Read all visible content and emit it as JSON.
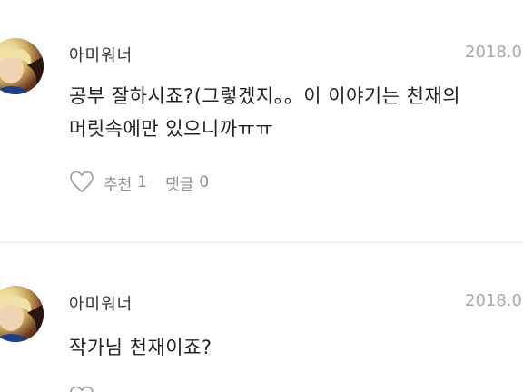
{
  "comments": [
    {
      "author": "아미워너",
      "date": "2018.0",
      "body_line1": "공부 잘하시죠?(그렇겠지。。이 이야기는 천재의",
      "body_line2": "머릿속에만 있으니까ㅠㅠ",
      "like_label": "추천",
      "like_count": "1",
      "reply_label": "댓글",
      "reply_count": "0"
    },
    {
      "author": "아미워너",
      "date": "2018.0",
      "body_line1": "작가님 천재이죠?"
    }
  ],
  "colors": {
    "text": "#222222",
    "muted": "#8e8e8e",
    "date": "#a9a9a9",
    "divider": "#e6e6e6"
  },
  "icons": {
    "avatar": "profile-photo",
    "like": "heart-outline-icon"
  }
}
